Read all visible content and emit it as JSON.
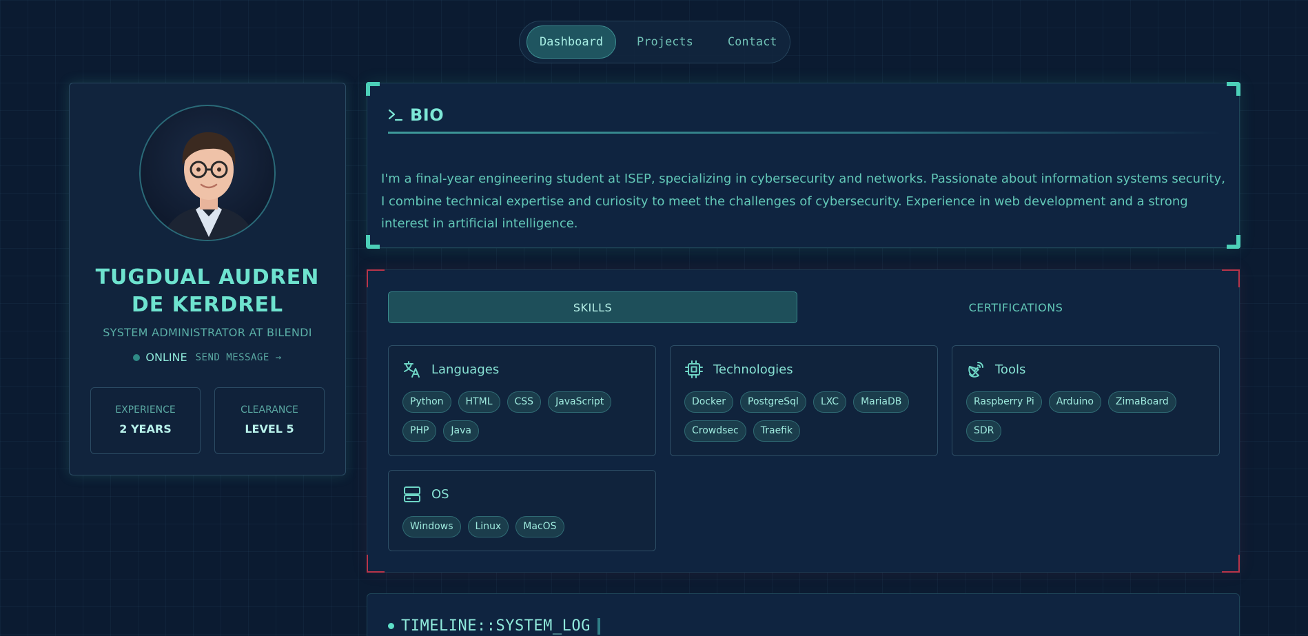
{
  "nav": {
    "items": [
      "Dashboard",
      "Projects",
      "Contact"
    ],
    "active": "Dashboard"
  },
  "profile": {
    "name": "TUGDUAL AUDREN DE KERDREL",
    "role": "SYSTEM ADMINISTRATOR AT BILENDI",
    "status": "ONLINE",
    "send_message": "SEND MESSAGE →",
    "stats": [
      {
        "label": "EXPERIENCE",
        "value": "2 YEARS"
      },
      {
        "label": "CLEARANCE",
        "value": "LEVEL 5"
      }
    ]
  },
  "bio": {
    "title": "BIO",
    "icon": "terminal-icon",
    "text": "I'm a final-year engineering student at ISEP, specializing in cybersecurity and networks. Passionate about information systems security, I combine technical expertise and curiosity to meet the challenges of cybersecurity. Experience in web development and a strong interest in artificial intelligence."
  },
  "skills": {
    "tabs": [
      "SKILLS",
      "CERTIFICATIONS"
    ],
    "active_tab": "SKILLS",
    "categories": [
      {
        "title": "Languages",
        "icon": "translate-icon",
        "tags": [
          "Python",
          "HTML",
          "CSS",
          "JavaScript",
          "PHP",
          "Java"
        ]
      },
      {
        "title": "Technologies",
        "icon": "cpu-icon",
        "tags": [
          "Docker",
          "PostgreSql",
          "LXC",
          "MariaDB",
          "Crowdsec",
          "Traefik"
        ]
      },
      {
        "title": "Tools",
        "icon": "satellite-dish-icon",
        "tags": [
          "Raspberry Pi",
          "Arduino",
          "ZimaBoard",
          "SDR"
        ]
      },
      {
        "title": "OS",
        "icon": "server-icon",
        "tags": [
          "Windows",
          "Linux",
          "MacOS"
        ]
      }
    ]
  },
  "timeline": {
    "title": "TIMELINE::SYSTEM_LOG"
  },
  "colors": {
    "background": "#0b1b31",
    "accent": "#5fd9c6",
    "panel": "#0f2440",
    "alert_corner": "#b9354a"
  }
}
